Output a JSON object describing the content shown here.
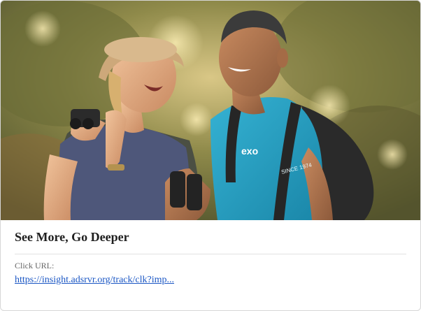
{
  "card": {
    "title": "See More, Go Deeper",
    "click_label": "Click URL:",
    "click_url": "https://insight.adsrvr.org/track/clk?imp...",
    "link_color": "#1a56c4"
  },
  "hero": {
    "shirt_brand_text": "exo",
    "shirt_since_text": "SINCE 1974"
  }
}
